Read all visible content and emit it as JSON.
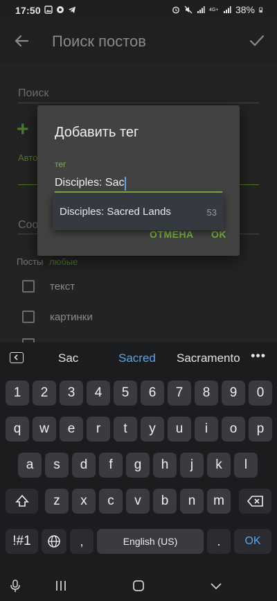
{
  "status_bar": {
    "time": "17:50",
    "battery": "38%",
    "network_label": "4G+",
    "left_icons": [
      "image-icon",
      "message-icon",
      "telegram-icon"
    ],
    "right_icons": [
      "alarm-icon",
      "mute-icon",
      "signal-icon",
      "signal-icon",
      "battery-icon"
    ]
  },
  "appbar": {
    "title": "Поиск постов",
    "back_icon": "arrow-left-icon",
    "confirm_icon": "check-icon"
  },
  "page": {
    "search_label": "Поиск",
    "author_label": "Авто",
    "community_label": "Соо",
    "posts_label": "Посты",
    "posts_value": "любые",
    "checkboxes": [
      "текст",
      "картинки"
    ]
  },
  "dialog": {
    "title": "Добавить тег",
    "field_label": "тег",
    "field_value": "Disciples: Sac",
    "cancel": "ОТМЕНА",
    "ok": "OK"
  },
  "suggestion": {
    "text": "Disciples: Sacred Lands",
    "count": "53"
  },
  "keyboard": {
    "suggestions": [
      "Sac",
      "Sacred",
      "Sacramento"
    ],
    "row_numbers": [
      "1",
      "2",
      "3",
      "4",
      "5",
      "6",
      "7",
      "8",
      "9",
      "0"
    ],
    "row1": [
      "q",
      "w",
      "e",
      "r",
      "t",
      "y",
      "u",
      "i",
      "o",
      "p"
    ],
    "row2": [
      "a",
      "s",
      "d",
      "f",
      "g",
      "h",
      "j",
      "k",
      "l"
    ],
    "row3": [
      "z",
      "x",
      "c",
      "v",
      "b",
      "n",
      "m"
    ],
    "symbols_key": "!#1",
    "space_label": "English (US)",
    "enter_label": "OK"
  },
  "colors": {
    "accent_green": "#7cb342",
    "keyboard_blue": "#5aa4f1",
    "dialog_bg": "#424242"
  }
}
